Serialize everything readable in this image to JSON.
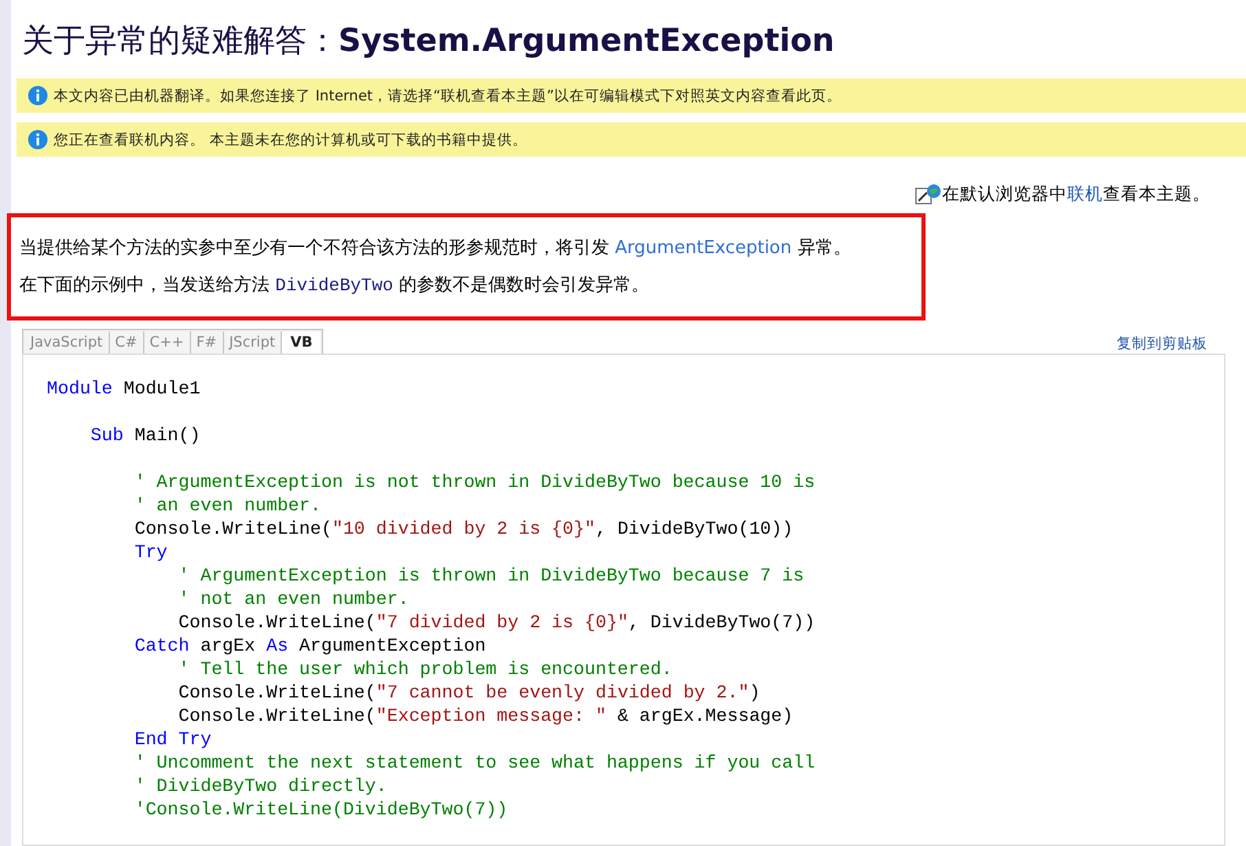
{
  "title": {
    "prefix": "关于异常的疑难解答：",
    "name": "System.ArgumentException"
  },
  "notices": [
    {
      "text": "本文内容已由机器翻译。如果您连接了 Internet，请选择“联机查看本主题”以在可编辑模式下对照英文内容查看此页。"
    },
    {
      "text": "您正在查看联机内容。 本主题未在您的计算机或可下载的书籍中提供。"
    }
  ],
  "online_link": {
    "before": "在默认浏览器中",
    "link": "联机",
    "after": "查看本主题。"
  },
  "description": [
    [
      {
        "kind": "text",
        "text": "当提供给某个方法的实参中至少有一个不符合该方法的形参规范时，将引发 "
      },
      {
        "kind": "link",
        "text": "ArgumentException"
      },
      {
        "kind": "text",
        "text": " 异常。"
      }
    ],
    [
      {
        "kind": "text",
        "text": "在下面的示例中，当发送给方法 "
      },
      {
        "kind": "code",
        "text": "DivideByTwo"
      },
      {
        "kind": "text",
        "text": " 的参数不是偶数时会引发异常。"
      }
    ]
  ],
  "tabs": [
    {
      "label": "JavaScript",
      "selected": false
    },
    {
      "label": "C#",
      "selected": false
    },
    {
      "label": "C++",
      "selected": false
    },
    {
      "label": "F#",
      "selected": false
    },
    {
      "label": "JScript",
      "selected": false
    },
    {
      "label": "VB",
      "selected": true
    }
  ],
  "copy_link": "复制到剪贴板",
  "code_blocks": [
    [
      [
        {
          "kind": "kw",
          "text": "Module"
        },
        {
          "kind": "plain",
          "text": " Module1"
        }
      ]
    ],
    [
      [
        {
          "kind": "kw",
          "text": "    Sub"
        },
        {
          "kind": "plain",
          "text": " Main()"
        }
      ]
    ],
    [
      [
        {
          "kind": "comment",
          "text": "        ' ArgumentException is not thrown in DivideByTwo because 10 is"
        }
      ],
      [
        {
          "kind": "comment",
          "text": "        ' an even number."
        }
      ],
      [
        {
          "kind": "plain",
          "text": "        Console.WriteLine("
        },
        {
          "kind": "str",
          "text": "\"10 divided by 2 is {0}\""
        },
        {
          "kind": "plain",
          "text": ", DivideByTwo(10))"
        }
      ],
      [
        {
          "kind": "kw",
          "text": "        Try"
        }
      ],
      [
        {
          "kind": "comment",
          "text": "            ' ArgumentException is thrown in DivideByTwo because 7 is"
        }
      ],
      [
        {
          "kind": "comment",
          "text": "            ' not an even number."
        }
      ],
      [
        {
          "kind": "plain",
          "text": "            Console.WriteLine("
        },
        {
          "kind": "str",
          "text": "\"7 divided by 2 is {0}\""
        },
        {
          "kind": "plain",
          "text": ", DivideByTwo(7))"
        }
      ],
      [
        {
          "kind": "kw",
          "text": "        Catch"
        },
        {
          "kind": "plain",
          "text": " argEx "
        },
        {
          "kind": "kw",
          "text": "As"
        },
        {
          "kind": "plain",
          "text": " ArgumentException"
        }
      ],
      [
        {
          "kind": "comment",
          "text": "            ' Tell the user which problem is encountered."
        }
      ],
      [
        {
          "kind": "plain",
          "text": "            Console.WriteLine("
        },
        {
          "kind": "str",
          "text": "\"7 cannot be evenly divided by 2.\""
        },
        {
          "kind": "plain",
          "text": ")"
        }
      ],
      [
        {
          "kind": "plain",
          "text": "            Console.WriteLine("
        },
        {
          "kind": "str",
          "text": "\"Exception message: \""
        },
        {
          "kind": "plain",
          "text": " & argEx.Message)"
        }
      ],
      [
        {
          "kind": "kw",
          "text": "        End Try"
        }
      ],
      [
        {
          "kind": "comment",
          "text": "        ' Uncomment the next statement to see what happens if you call"
        }
      ],
      [
        {
          "kind": "comment",
          "text": "        ' DivideByTwo directly."
        }
      ],
      [
        {
          "kind": "comment",
          "text": "        'Console.WriteLine(DivideByTwo(7))"
        }
      ]
    ]
  ]
}
